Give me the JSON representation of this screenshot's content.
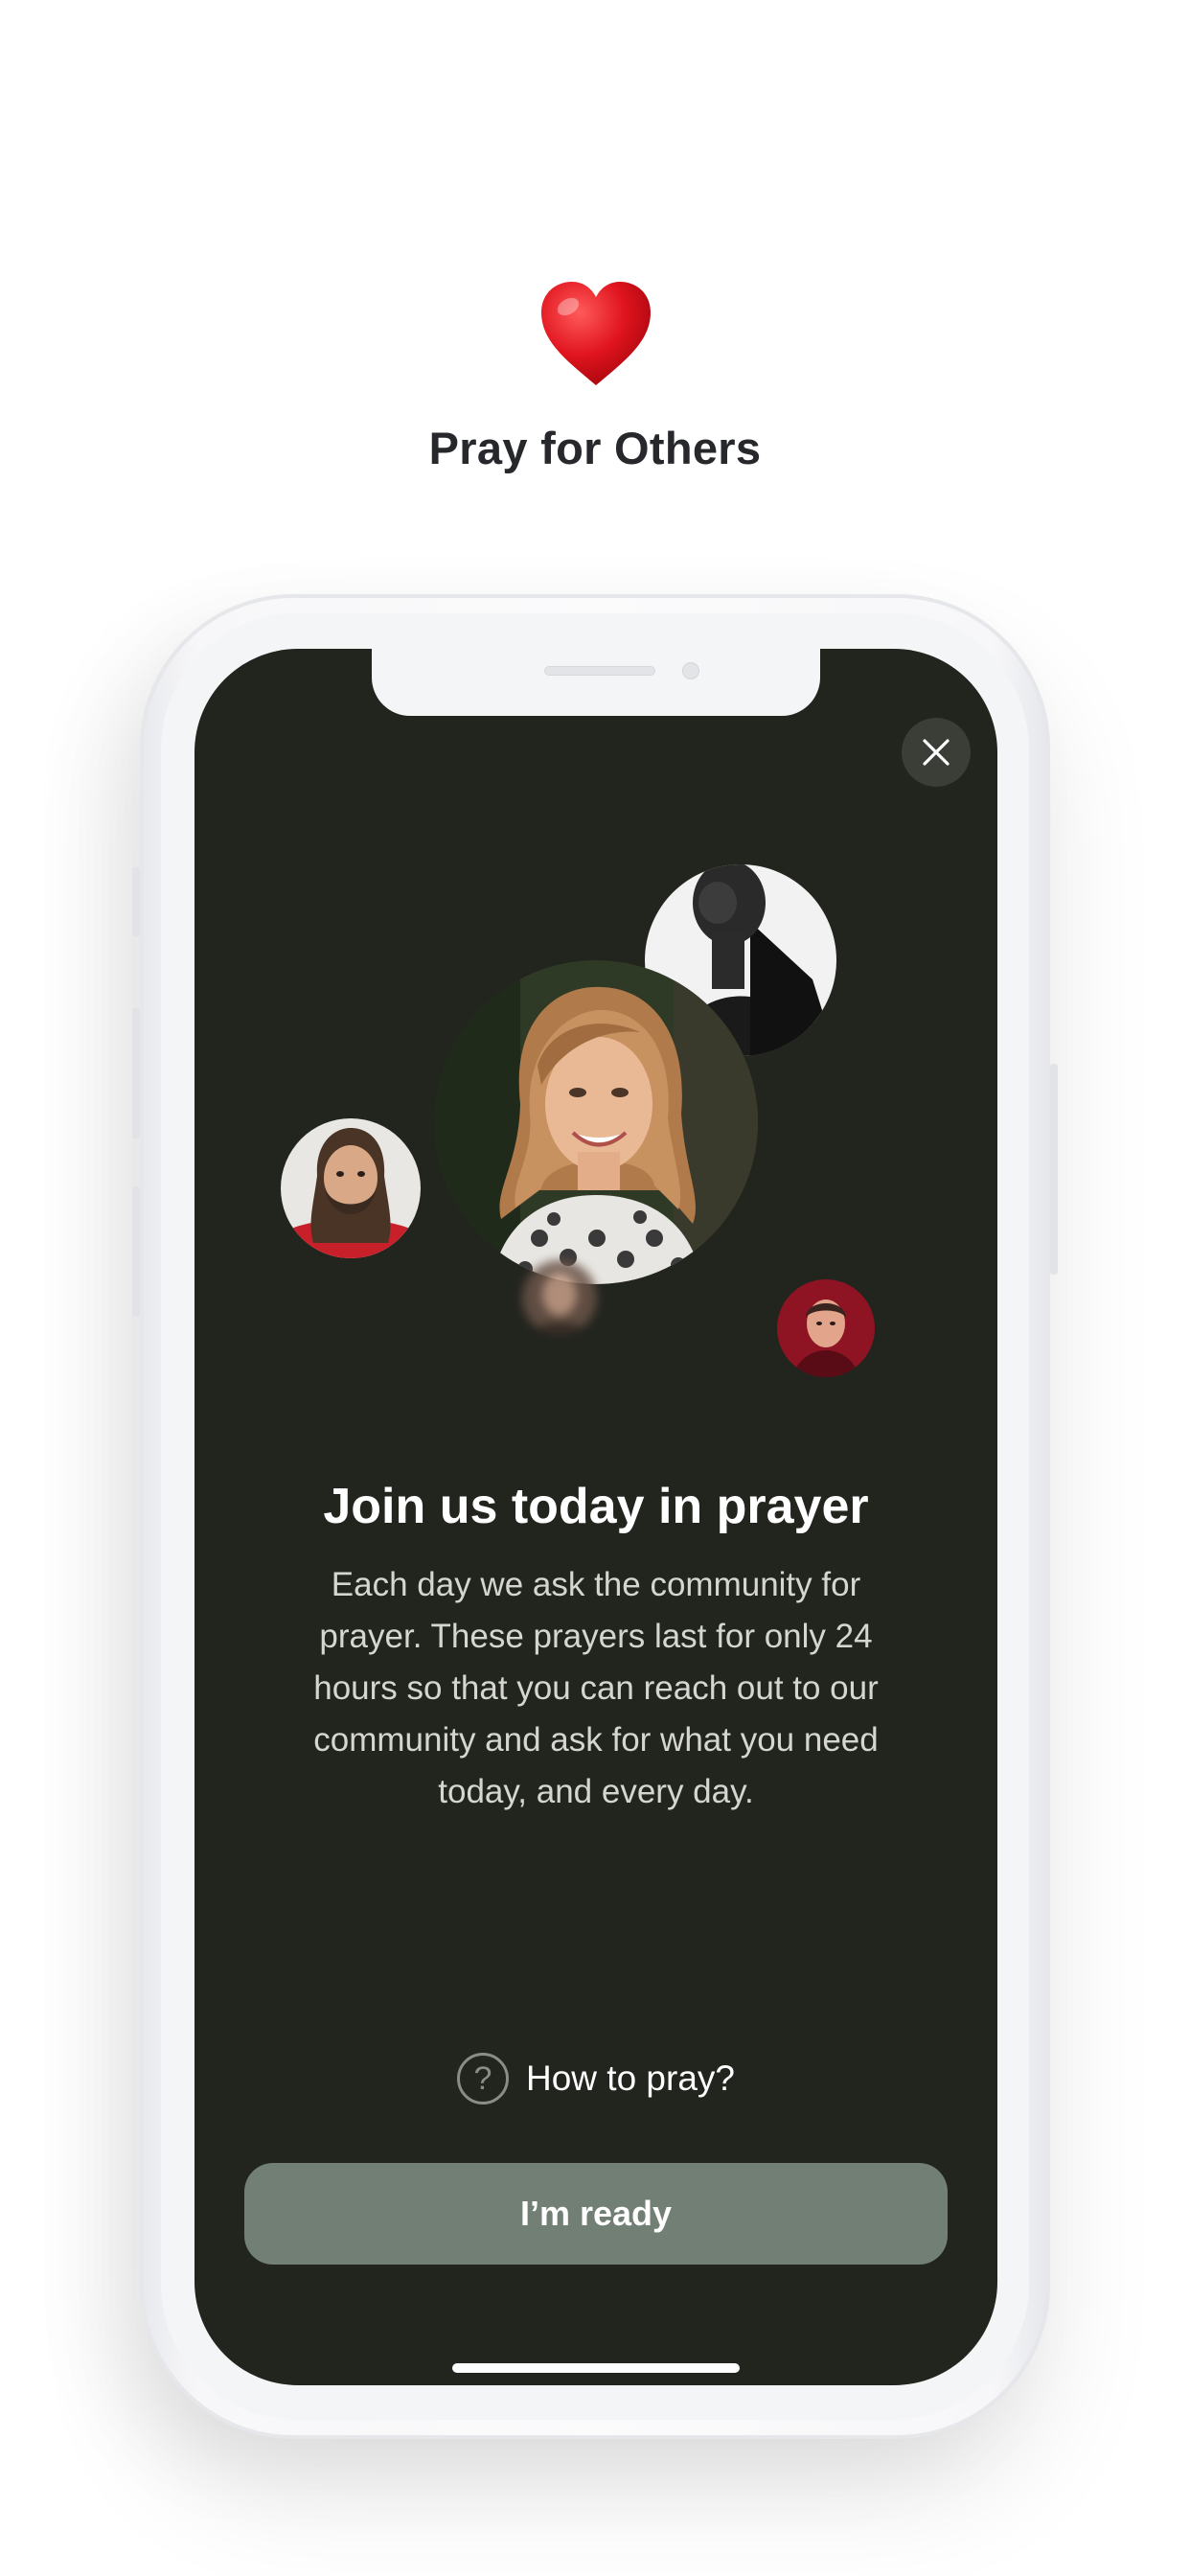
{
  "header": {
    "icon": "red-heart-icon",
    "title": "Pray for Others"
  },
  "screen": {
    "close_icon": "close-icon",
    "avatars": [
      "portrait-woman-smiling",
      "portrait-man-black-and-white",
      "portrait-man-beard",
      "portrait-man-red-background",
      "portrait-blurred"
    ],
    "title": "Join us today in prayer",
    "body": "Each day we ask the community for prayer. These prayers last for only 24 hours so that you can reach out to our community and ask for what you need today, and every day.",
    "help_link": {
      "icon": "question-circle-icon",
      "glyph": "?",
      "label": "How to pray?"
    },
    "primary_button": "I’m ready"
  },
  "colors": {
    "screen_background": "#22241e",
    "primary_button": "#727f74",
    "heart": "#e0141e"
  }
}
